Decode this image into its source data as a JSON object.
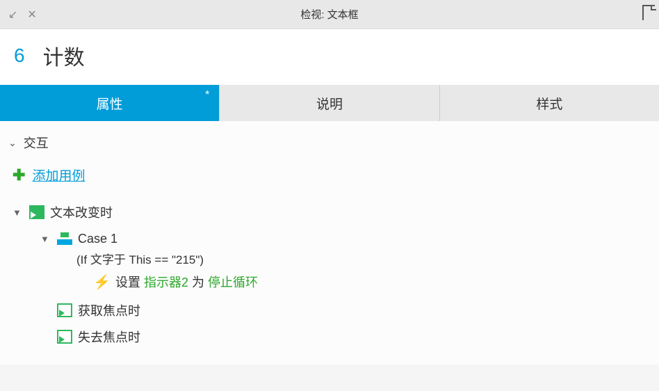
{
  "titlebar": {
    "title": "检视: 文本框"
  },
  "header": {
    "number": "6",
    "title": "计数"
  },
  "tabs": [
    {
      "label": "属性",
      "active": true,
      "dirty": true
    },
    {
      "label": "说明",
      "active": false,
      "dirty": false
    },
    {
      "label": "样式",
      "active": false,
      "dirty": false
    }
  ],
  "section": {
    "title": "交互"
  },
  "addCase": {
    "label": "添加用例"
  },
  "events": {
    "textChange": {
      "label": "文本改变时",
      "case": {
        "label": "Case 1",
        "condition": "(If 文字于 This == \"215\")",
        "action": {
          "prefix": "设置 ",
          "target": "指示器2",
          "mid": " 为 ",
          "value": "停止循环"
        }
      }
    },
    "focusGained": {
      "label": "获取焦点时"
    },
    "focusLost": {
      "label": "失去焦点时"
    }
  }
}
